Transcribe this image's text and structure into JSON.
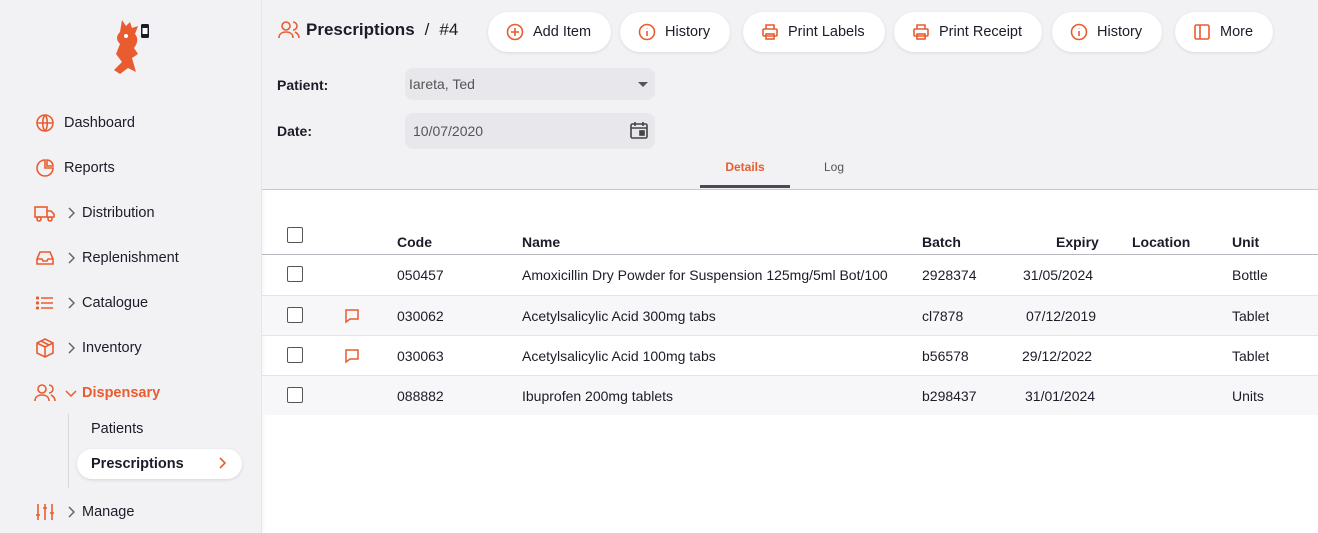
{
  "colors": {
    "accent": "#e95c30",
    "sidebar_bg": "#f2f2f5"
  },
  "sidebar": {
    "items": [
      {
        "label": "Dashboard",
        "icon": "globe-icon"
      },
      {
        "label": "Reports",
        "icon": "pie-chart-icon"
      },
      {
        "label": "Distribution",
        "icon": "truck-icon"
      },
      {
        "label": "Replenishment",
        "icon": "inbox-icon"
      },
      {
        "label": "Catalogue",
        "icon": "list-icon"
      },
      {
        "label": "Inventory",
        "icon": "box-icon"
      },
      {
        "label": "Dispensary",
        "icon": "users-icon"
      },
      {
        "label": "Manage",
        "icon": "sliders-icon"
      }
    ],
    "sub_items": [
      {
        "label": "Patients"
      },
      {
        "label": "Prescriptions"
      }
    ]
  },
  "header": {
    "breadcrumb_section": "Prescriptions",
    "breadcrumb_sep": "/",
    "breadcrumb_id": "#4",
    "buttons": [
      {
        "label": "Add Item",
        "icon": "plus-circle-icon"
      },
      {
        "label": "History",
        "icon": "info-icon"
      },
      {
        "label": "Print Labels",
        "icon": "printer-icon"
      },
      {
        "label": "Print Receipt",
        "icon": "printer-icon"
      },
      {
        "label": "History",
        "icon": "info-icon"
      },
      {
        "label": "More",
        "icon": "sidebar-panel-icon"
      }
    ]
  },
  "form": {
    "patient_label": "Patient:",
    "patient_value": "Iareta, Ted",
    "date_label": "Date:",
    "date_value": "10/07/2020"
  },
  "tabs": [
    {
      "label": "Details",
      "active": true
    },
    {
      "label": "Log",
      "active": false
    }
  ],
  "table": {
    "columns": [
      "Code",
      "Name",
      "Batch",
      "Expiry",
      "Location",
      "Unit"
    ],
    "rows": [
      {
        "code": "050457",
        "name": "Amoxicillin Dry Powder for Suspension 125mg/5ml Bot/100",
        "batch": "2928374",
        "expiry": "31/05/2024",
        "location": "",
        "unit": "Bottle",
        "note": false
      },
      {
        "code": "030062",
        "name": "Acetylsalicylic Acid 300mg tabs",
        "batch": "cl7878",
        "expiry": "07/12/2019",
        "location": "",
        "unit": "Tablet",
        "note": true
      },
      {
        "code": "030063",
        "name": "Acetylsalicylic Acid 100mg tabs",
        "batch": "b56578",
        "expiry": "29/12/2022",
        "location": "",
        "unit": "Tablet",
        "note": true
      },
      {
        "code": "088882",
        "name": "Ibuprofen 200mg tablets",
        "batch": "b298437",
        "expiry": "31/01/2024",
        "location": "",
        "unit": "Units",
        "note": false
      }
    ]
  }
}
